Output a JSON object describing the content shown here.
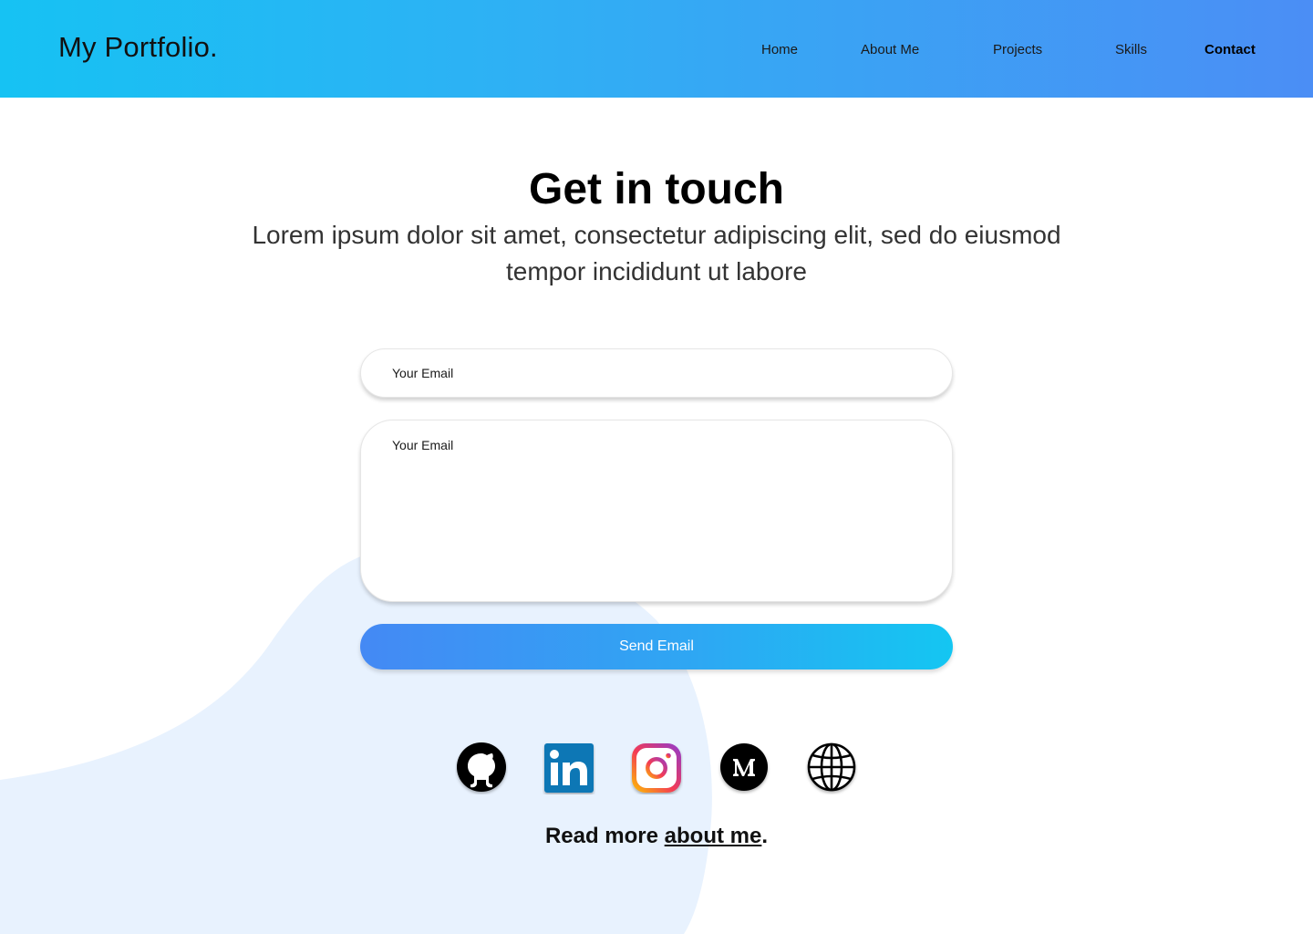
{
  "header": {
    "brand": "My Portfolio.",
    "nav": {
      "home": "Home",
      "about": "About Me",
      "projects": "Projects",
      "skills": "Skills",
      "contact": "Contact"
    },
    "active_item": "Contact"
  },
  "hero": {
    "title": "Get in touch",
    "subtitle": "Lorem ipsum dolor sit amet, consectetur adipiscing elit, sed do eiusmod tempor incididunt ut labore"
  },
  "form": {
    "email_placeholder": "Your Email",
    "message_placeholder": "Your Email",
    "send_label": "Send Email"
  },
  "socials": {
    "icons": [
      "github-icon",
      "linkedin-icon",
      "instagram-icon",
      "medium-icon",
      "globe-icon"
    ]
  },
  "footer": {
    "read_prefix": "Read more ",
    "read_link": "about me",
    "read_suffix": "."
  },
  "colors": {
    "header_gradient_start": "#16c2f3",
    "header_gradient_end": "#4b8ef5",
    "button_gradient_start": "#4489f4",
    "button_gradient_end": "#14c6f2",
    "blob": "#e8f2fe",
    "linkedin": "#0a77b5"
  }
}
